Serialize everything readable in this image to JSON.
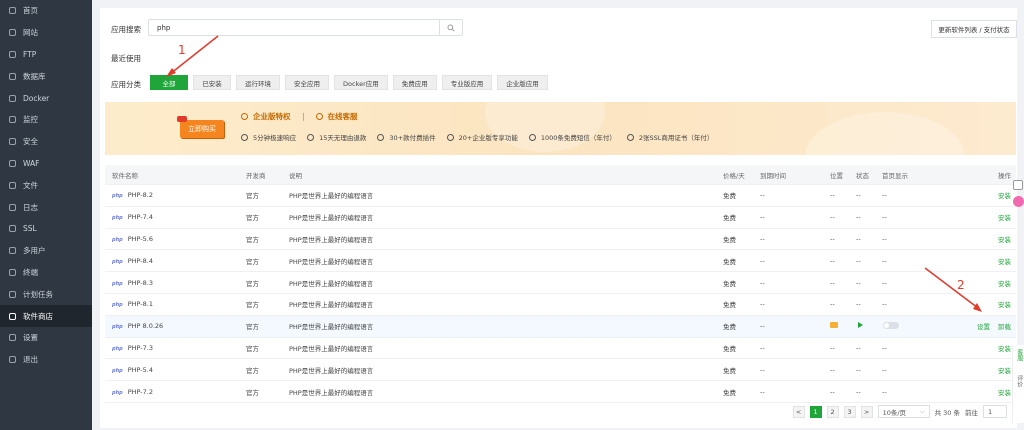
{
  "sidebar": {
    "items": [
      {
        "label": "首页",
        "icon": "home-icon"
      },
      {
        "label": "网站",
        "icon": "globe-icon"
      },
      {
        "label": "FTP",
        "icon": "ftp-icon"
      },
      {
        "label": "数据库",
        "icon": "database-icon"
      },
      {
        "label": "Docker",
        "icon": "docker-icon"
      },
      {
        "label": "监控",
        "icon": "monitor-icon"
      },
      {
        "label": "安全",
        "icon": "shield-icon"
      },
      {
        "label": "WAF",
        "icon": "waf-icon"
      },
      {
        "label": "文件",
        "icon": "folder-icon"
      },
      {
        "label": "日志",
        "icon": "log-icon"
      },
      {
        "label": "SSL",
        "icon": "ssl-icon"
      },
      {
        "label": "多用户",
        "icon": "users-icon"
      },
      {
        "label": "终端",
        "icon": "terminal-icon"
      },
      {
        "label": "计划任务",
        "icon": "schedule-icon"
      },
      {
        "label": "软件商店",
        "icon": "grid-icon",
        "active": true
      },
      {
        "label": "设置",
        "icon": "gear-icon"
      },
      {
        "label": "退出",
        "icon": "logout-icon"
      }
    ]
  },
  "search": {
    "label": "应用搜索",
    "value": "php"
  },
  "update_button": "更新软件列表 / 支付状态",
  "recent": {
    "label": "最近使用"
  },
  "categories": {
    "label": "应用分类",
    "items": [
      "全部",
      "已安装",
      "运行环境",
      "安全应用",
      "Docker应用",
      "免费应用",
      "专业版应用",
      "企业版应用"
    ],
    "active_index": 0
  },
  "banner": {
    "buy": "立即购买",
    "title": "企业版特权",
    "service": "在线客服",
    "features": [
      "5分钟极速响应",
      "15天无理由退款",
      "30+款付费插件",
      "20+企业版专享功能",
      "1000条免费短信（年付）",
      "2张SSL商用证书（年付）"
    ]
  },
  "table": {
    "headers": {
      "name": "软件名称",
      "developer": "开发商",
      "desc": "说明",
      "price": "价格/天",
      "expire": "到期时间",
      "location": "位置",
      "status": "状态",
      "homepage": "首页显示",
      "action": "操作"
    },
    "rows": [
      {
        "name": "PHP-8.2",
        "developer": "官方",
        "desc": "PHP是世界上最好的编程语言",
        "price": "免费",
        "expire": "--",
        "location": "--",
        "status": "--",
        "homepage": "--",
        "action": "安装"
      },
      {
        "name": "PHP-7.4",
        "developer": "官方",
        "desc": "PHP是世界上最好的编程语言",
        "price": "免费",
        "expire": "--",
        "location": "--",
        "status": "--",
        "homepage": "--",
        "action": "安装"
      },
      {
        "name": "PHP-5.6",
        "developer": "官方",
        "desc": "PHP是世界上最好的编程语言",
        "price": "免费",
        "expire": "--",
        "location": "--",
        "status": "--",
        "homepage": "--",
        "action": "安装"
      },
      {
        "name": "PHP-8.4",
        "developer": "官方",
        "desc": "PHP是世界上最好的编程语言",
        "price": "免费",
        "expire": "--",
        "location": "--",
        "status": "--",
        "homepage": "--",
        "action": "安装"
      },
      {
        "name": "PHP-8.3",
        "developer": "官方",
        "desc": "PHP是世界上最好的编程语言",
        "price": "免费",
        "expire": "--",
        "location": "--",
        "status": "--",
        "homepage": "--",
        "action": "安装"
      },
      {
        "name": "PHP-8.1",
        "developer": "官方",
        "desc": "PHP是世界上最好的编程语言",
        "price": "免费",
        "expire": "--",
        "location": "--",
        "status": "--",
        "homepage": "--",
        "action": "安装"
      },
      {
        "name": "PHP 8.0.26",
        "developer": "官方",
        "desc": "PHP是世界上最好的编程语言",
        "price": "免费",
        "expire": "--",
        "installed": true,
        "action": "设置",
        "action2": "卸载"
      },
      {
        "name": "PHP-7.3",
        "developer": "官方",
        "desc": "PHP是世界上最好的编程语言",
        "price": "免费",
        "expire": "--",
        "location": "--",
        "status": "--",
        "homepage": "--",
        "action": "安装"
      },
      {
        "name": "PHP-5.4",
        "developer": "官方",
        "desc": "PHP是世界上最好的编程语言",
        "price": "免费",
        "expire": "--",
        "location": "--",
        "status": "--",
        "homepage": "--",
        "action": "安装"
      },
      {
        "name": "PHP-7.2",
        "developer": "官方",
        "desc": "PHP是世界上最好的编程语言",
        "price": "免费",
        "expire": "--",
        "location": "--",
        "status": "--",
        "homepage": "--",
        "action": "安装"
      }
    ]
  },
  "pagination": {
    "prev": "<",
    "next": ">",
    "pages": [
      "1",
      "2",
      "3"
    ],
    "current": "1",
    "per_page": "10条/页",
    "total": "共 30 条",
    "goto_label": "前往",
    "goto_value": "1"
  },
  "annotations": [
    "1",
    "2"
  ],
  "float": {
    "service": "客服",
    "review": "评价"
  },
  "colors": {
    "accent": "#20a53a",
    "sidebar_bg": "#2f3743",
    "annotation": "#e23a2b",
    "buy": "#f5851f"
  }
}
